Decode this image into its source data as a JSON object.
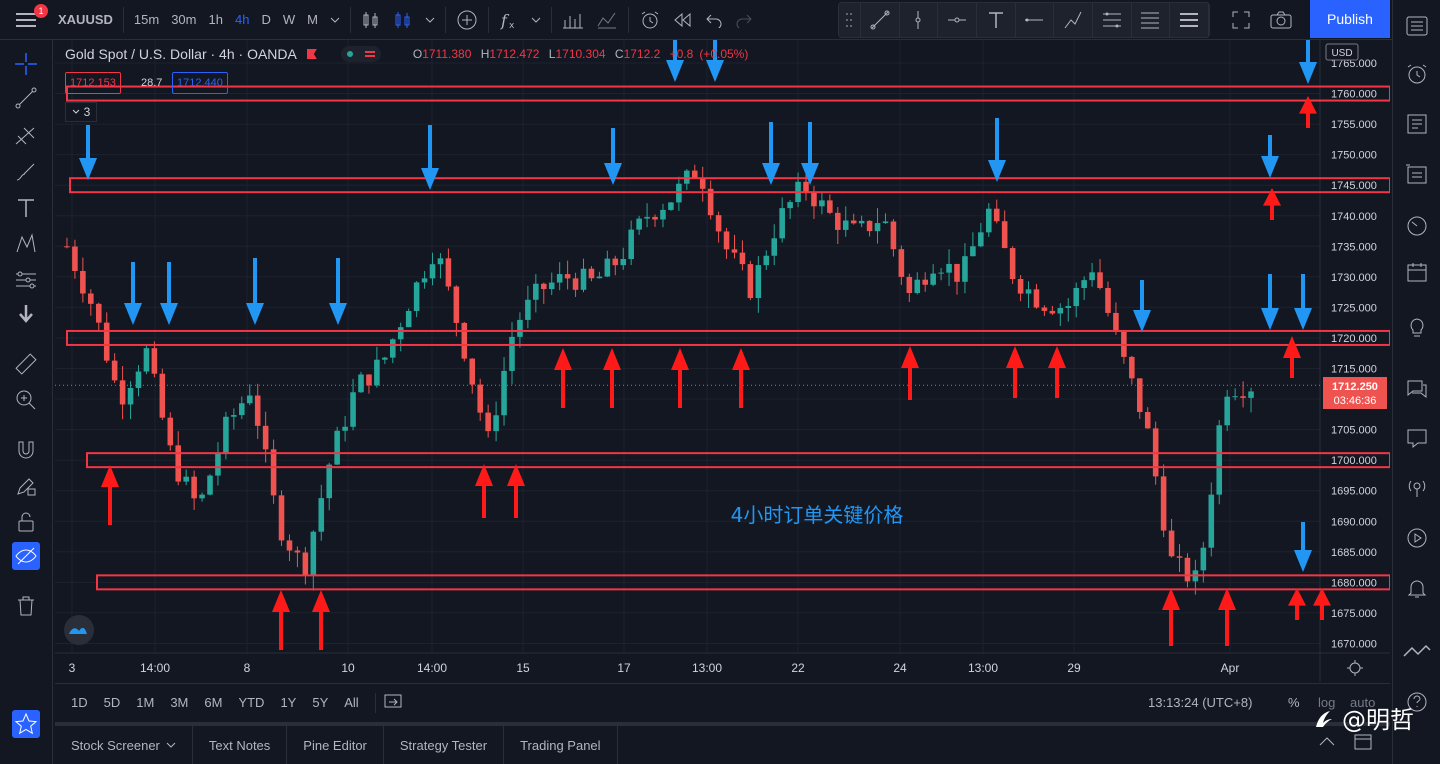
{
  "topbar": {
    "symbol": "XAUUSD",
    "timeframes": [
      "15m",
      "30m",
      "1h",
      "4h",
      "D",
      "W",
      "M"
    ],
    "active_timeframe": "4h",
    "notification_count": "1",
    "publish_label": "Publish"
  },
  "legend": {
    "title": "Gold Spot / U.S. Dollar · 4h · OANDA",
    "o_label": "O",
    "o": "1711.380",
    "h_label": "H",
    "h": "1712.472",
    "l_label": "L",
    "l": "1710.304",
    "c_label": "C",
    "c": "1712.2",
    "change": "+0.8",
    "change_pct": "(+0.05%)",
    "bid": "1712.153",
    "spread": "28.7",
    "ask": "1712.440",
    "indicators_count": "3"
  },
  "axis": {
    "currency": "USD",
    "price_ticks": [
      "1765.000",
      "1760.000",
      "1755.000",
      "1750.000",
      "1745.000",
      "1740.000",
      "1735.000",
      "1730.000",
      "1725.000",
      "1720.000",
      "1715.000",
      "1710.000",
      "1705.000",
      "1700.000",
      "1695.000",
      "1690.000",
      "1685.000",
      "1680.000",
      "1675.000",
      "1670.000"
    ],
    "current_price": "1712.250",
    "countdown": "03:46:36",
    "time_ticks": [
      "3",
      "14:00",
      "8",
      "10",
      "14:00",
      "15",
      "17",
      "13:00",
      "22",
      "24",
      "13:00",
      "29",
      "Apr"
    ]
  },
  "annotation": {
    "text": "4小时订单关键价格",
    "key_levels": [
      1760,
      1745,
      1720,
      1700,
      1680
    ]
  },
  "chart_data": {
    "type": "candlestick",
    "symbol": "XAUUSD",
    "interval": "4h",
    "ylim": [
      1667,
      1767
    ],
    "approx_close_path": [
      1735,
      1725,
      1710,
      1718,
      1700,
      1692,
      1705,
      1712,
      1690,
      1682,
      1700,
      1712,
      1716,
      1726,
      1735,
      1720,
      1703,
      1722,
      1728,
      1730,
      1729,
      1733,
      1740,
      1743,
      1748,
      1735,
      1728,
      1739,
      1745,
      1740,
      1737,
      1740,
      1727,
      1733,
      1730,
      1741,
      1730,
      1726,
      1725,
      1732,
      1718,
      1706,
      1683,
      1680,
      1712,
      1712.25
    ],
    "current": 1712.25
  },
  "bottombar": {
    "ranges": [
      "1D",
      "5D",
      "1M",
      "3M",
      "6M",
      "YTD",
      "1Y",
      "5Y",
      "All"
    ],
    "clock": "13:13:24 (UTC+8)",
    "pct": "%",
    "log": "log",
    "auto": "auto"
  },
  "panels": [
    "Stock Screener",
    "Text Notes",
    "Pine Editor",
    "Strategy Tester",
    "Trading Panel"
  ],
  "watermark": "@明哲",
  "colors": {
    "bg": "#131722",
    "up": "#26a69a",
    "down": "#ef5350",
    "accent": "#2962ff",
    "level_line": "#f23645",
    "arrow_blue": "#2196f3",
    "arrow_red": "#ff1a1a"
  }
}
